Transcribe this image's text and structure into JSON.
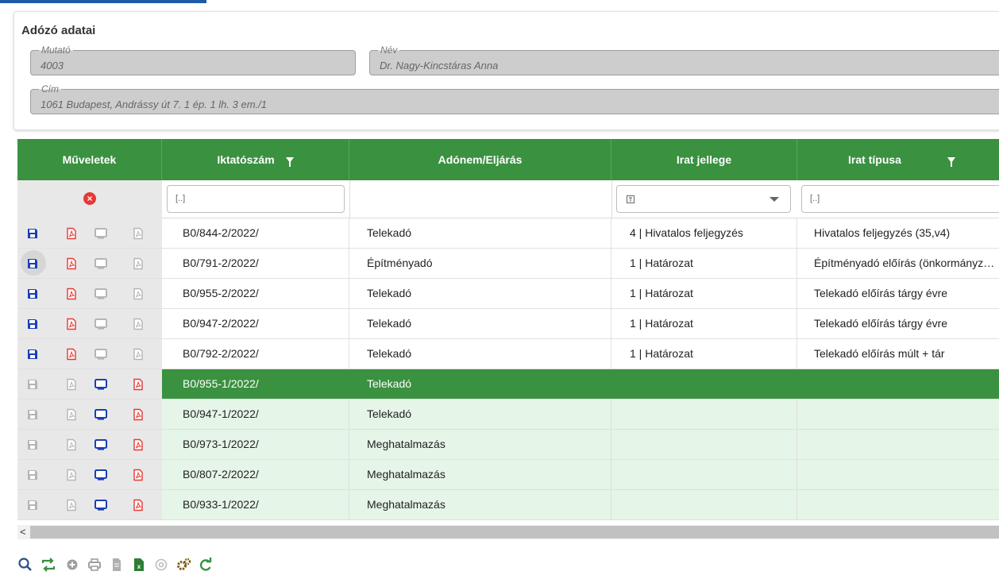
{
  "panel": {
    "title": "Adózó adatai",
    "mutato": {
      "label": "Mutató",
      "value": "4003"
    },
    "nev": {
      "label": "Név",
      "value": "Dr. Nagy-Kincstáras Anna"
    },
    "cim": {
      "label": "Cím",
      "value": "1061 Budapest, Andrássy út 7. 1 ép. 1 lh. 3 em./1"
    }
  },
  "grid": {
    "headers": {
      "muveletek": "Műveletek",
      "iktatoszam": "Iktatószám",
      "adonem": "Adónem/Eljárás",
      "irat_jellege": "Irat jellege",
      "irat_tipusa": "Irat típusa"
    },
    "filters": {
      "iktatoszam": "[..]",
      "irat_jellege": "",
      "irat_tipusa": "[..]"
    },
    "rows": [
      {
        "iktatoszam": "B0/844-2/2022/",
        "adonem": "Telekadó",
        "jelleg": "4 | Hivatalos feljegyzés",
        "tipus": "Hivatalos feljegyzés (35,v4)",
        "style": "white"
      },
      {
        "iktatoszam": "B0/791-2/2022/",
        "adonem": "Építményadó",
        "jelleg": "1 | Határozat",
        "tipus": "Építményadó előírás (önkormányzati)",
        "style": "white"
      },
      {
        "iktatoszam": "B0/955-2/2022/",
        "adonem": "Telekadó",
        "jelleg": "1 | Határozat",
        "tipus": "Telekadó előírás tárgy évre",
        "style": "white"
      },
      {
        "iktatoszam": "B0/947-2/2022/",
        "adonem": "Telekadó",
        "jelleg": "1 | Határozat",
        "tipus": "Telekadó előírás tárgy évre",
        "style": "white"
      },
      {
        "iktatoszam": "B0/792-2/2022/",
        "adonem": "Telekadó",
        "jelleg": "1 | Határozat",
        "tipus": "Telekadó előírás múlt + tár",
        "style": "white"
      },
      {
        "iktatoszam": "B0/955-1/2022/",
        "adonem": "Telekadó",
        "jelleg": "",
        "tipus": "",
        "style": "sel"
      },
      {
        "iktatoszam": "B0/947-1/2022/",
        "adonem": "Telekadó",
        "jelleg": "",
        "tipus": "",
        "style": "light"
      },
      {
        "iktatoszam": "B0/973-1/2022/",
        "adonem": "Meghatalmazás",
        "jelleg": "",
        "tipus": "",
        "style": "light"
      },
      {
        "iktatoszam": "B0/807-2/2022/",
        "adonem": "Meghatalmazás",
        "jelleg": "",
        "tipus": "",
        "style": "light"
      },
      {
        "iktatoszam": "B0/933-1/2022/",
        "adonem": "Meghatalmazás",
        "jelleg": "",
        "tipus": "",
        "style": "light"
      }
    ]
  },
  "scrollbar": {
    "left_arrow": "<"
  },
  "colors": {
    "green": "#3a9140",
    "light_green": "#e5f5e7",
    "blue": "#1a3fb5",
    "red": "#e53935"
  },
  "toolbar": {
    "icons": [
      "search-icon",
      "refresh-swap-icon",
      "add-icon",
      "print-icon",
      "document-icon",
      "excel-icon",
      "email-icon",
      "settings-icon",
      "reload-icon"
    ]
  }
}
